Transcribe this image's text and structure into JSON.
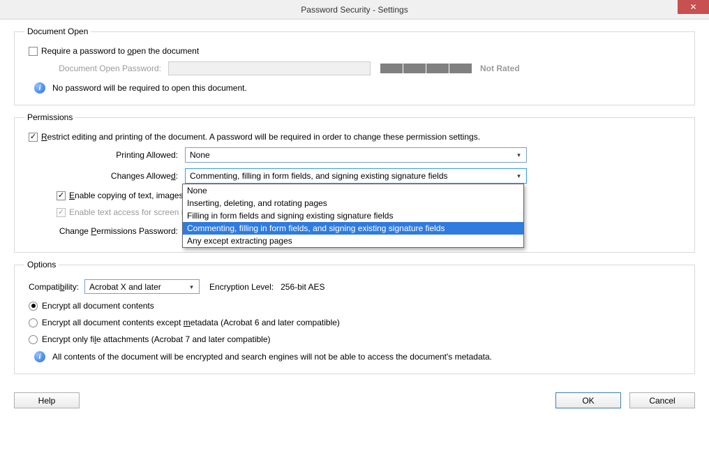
{
  "window": {
    "title": "Password Security - Settings"
  },
  "document_open": {
    "legend": "Document Open",
    "require_checkbox_label_pre": "Require a password to ",
    "require_checkbox_label_u": "o",
    "require_checkbox_label_post": "pen the document",
    "password_label": "Document Open Password:",
    "rating": "Not Rated",
    "info": "No password will be required to open this document."
  },
  "permissions": {
    "legend": "Permissions",
    "restrict_label_u": "R",
    "restrict_label_post": "estrict editing and printing of the document. A password will be required in order to change these permission settings.",
    "printing_label": "Printing Allowed:",
    "printing_value": "None",
    "changes_label_pre": "Changes Allowe",
    "changes_label_u": "d",
    "changes_label_post": ":",
    "changes_value": "Commenting, filling in form fields, and signing existing signature fields",
    "changes_options": [
      "None",
      "Inserting, deleting, and rotating pages",
      "Filling in form fields and signing existing signature fields",
      "Commenting, filling in form fields, and signing existing signature fields",
      "Any except extracting pages"
    ],
    "changes_highlight_index": 3,
    "enable_copy_label_u": "E",
    "enable_copy_label_visible": "nable copying of text, images, an",
    "enable_access_label_visible": "Enable text access for screen reade",
    "change_pw_label_pre": "Change ",
    "change_pw_label_u": "P",
    "change_pw_label_post": "ermissions Password:",
    "change_pw_value": "****"
  },
  "options": {
    "legend": "Options",
    "compat_label_pre": "Compati",
    "compat_label_u": "b",
    "compat_label_post": "ility:",
    "compat_value": "Acrobat X and later",
    "enc_level_label": "Encryption Level:",
    "enc_level_value": "256-bit AES",
    "radio1": "Encrypt all document contents",
    "radio2_pre": "Encrypt all document contents except ",
    "radio2_u": "m",
    "radio2_post": "etadata (Acrobat 6 and later compatible)",
    "radio3_pre": "Encrypt only fi",
    "radio3_u": "l",
    "radio3_post": "e attachments (Acrobat 7 and later compatible)",
    "info": "All contents of the document will be encrypted and search engines will not be able to access the document's metadata."
  },
  "buttons": {
    "help": "Help",
    "ok": "OK",
    "cancel": "Cancel"
  }
}
